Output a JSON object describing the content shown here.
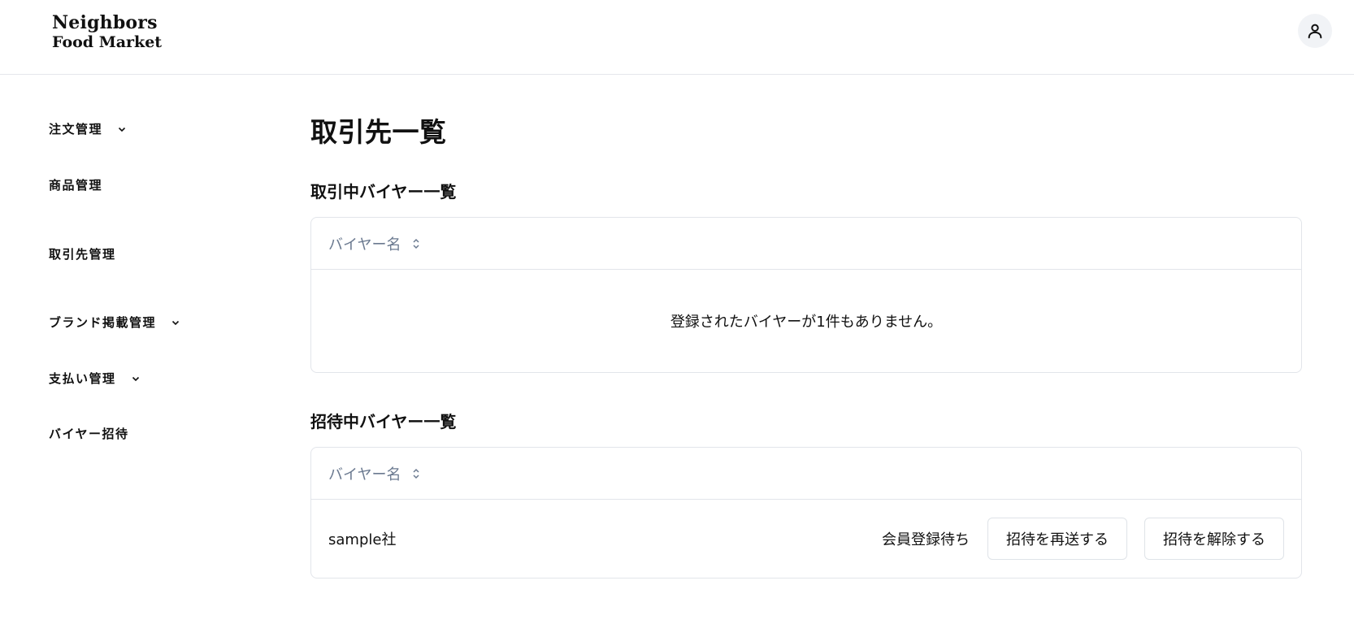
{
  "header": {
    "logo_line1": "Neighbors",
    "logo_line2": "Food Market",
    "avatar_icon": "user-icon"
  },
  "sidebar": {
    "items": [
      {
        "label": "注文管理",
        "has_chevron": true
      },
      {
        "label": "商品管理",
        "has_chevron": false
      },
      {
        "label": "取引先管理",
        "has_chevron": false
      },
      {
        "label": "ブランド掲載管理",
        "has_chevron": true
      },
      {
        "label": "支払い管理",
        "has_chevron": true
      },
      {
        "label": "バイヤー招待",
        "has_chevron": false
      }
    ]
  },
  "main": {
    "page_title": "取引先一覧",
    "active_section": {
      "title": "取引中バイヤー一覧",
      "column_label": "バイヤー名",
      "empty_message": "登録されたバイヤーが1件もありません。"
    },
    "invited_section": {
      "title": "招待中バイヤー一覧",
      "column_label": "バイヤー名",
      "rows": [
        {
          "name": "sample社",
          "status": "会員登録待ち",
          "resend_label": "招待を再送する",
          "cancel_label": "招待を解除する"
        }
      ]
    }
  },
  "colors": {
    "text": "#111111",
    "muted_header": "#6b7a90",
    "border": "#e2e5ea",
    "avatar_bg": "#f1f3f6"
  }
}
